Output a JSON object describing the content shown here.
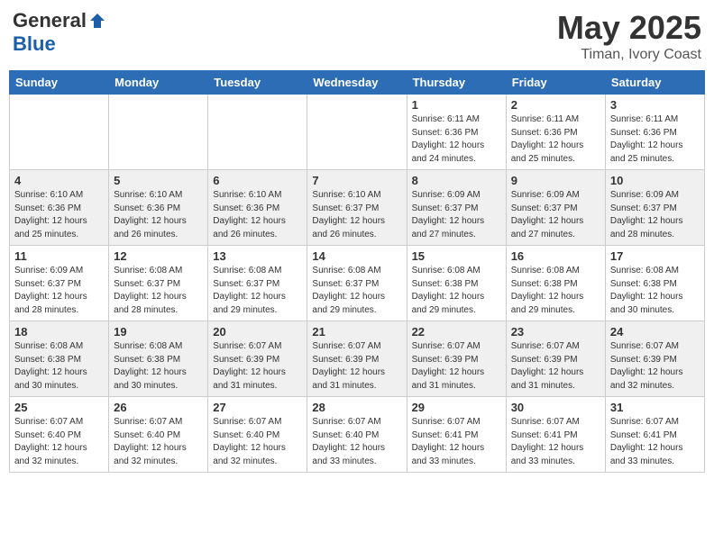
{
  "header": {
    "logo_general": "General",
    "logo_blue": "Blue",
    "title": "May 2025",
    "location": "Timan, Ivory Coast"
  },
  "weekdays": [
    "Sunday",
    "Monday",
    "Tuesday",
    "Wednesday",
    "Thursday",
    "Friday",
    "Saturday"
  ],
  "rows": [
    [
      {
        "day": "",
        "info": ""
      },
      {
        "day": "",
        "info": ""
      },
      {
        "day": "",
        "info": ""
      },
      {
        "day": "",
        "info": ""
      },
      {
        "day": "1",
        "info": "Sunrise: 6:11 AM\nSunset: 6:36 PM\nDaylight: 12 hours\nand 24 minutes."
      },
      {
        "day": "2",
        "info": "Sunrise: 6:11 AM\nSunset: 6:36 PM\nDaylight: 12 hours\nand 25 minutes."
      },
      {
        "day": "3",
        "info": "Sunrise: 6:11 AM\nSunset: 6:36 PM\nDaylight: 12 hours\nand 25 minutes."
      }
    ],
    [
      {
        "day": "4",
        "info": "Sunrise: 6:10 AM\nSunset: 6:36 PM\nDaylight: 12 hours\nand 25 minutes."
      },
      {
        "day": "5",
        "info": "Sunrise: 6:10 AM\nSunset: 6:36 PM\nDaylight: 12 hours\nand 26 minutes."
      },
      {
        "day": "6",
        "info": "Sunrise: 6:10 AM\nSunset: 6:36 PM\nDaylight: 12 hours\nand 26 minutes."
      },
      {
        "day": "7",
        "info": "Sunrise: 6:10 AM\nSunset: 6:37 PM\nDaylight: 12 hours\nand 26 minutes."
      },
      {
        "day": "8",
        "info": "Sunrise: 6:09 AM\nSunset: 6:37 PM\nDaylight: 12 hours\nand 27 minutes."
      },
      {
        "day": "9",
        "info": "Sunrise: 6:09 AM\nSunset: 6:37 PM\nDaylight: 12 hours\nand 27 minutes."
      },
      {
        "day": "10",
        "info": "Sunrise: 6:09 AM\nSunset: 6:37 PM\nDaylight: 12 hours\nand 28 minutes."
      }
    ],
    [
      {
        "day": "11",
        "info": "Sunrise: 6:09 AM\nSunset: 6:37 PM\nDaylight: 12 hours\nand 28 minutes."
      },
      {
        "day": "12",
        "info": "Sunrise: 6:08 AM\nSunset: 6:37 PM\nDaylight: 12 hours\nand 28 minutes."
      },
      {
        "day": "13",
        "info": "Sunrise: 6:08 AM\nSunset: 6:37 PM\nDaylight: 12 hours\nand 29 minutes."
      },
      {
        "day": "14",
        "info": "Sunrise: 6:08 AM\nSunset: 6:37 PM\nDaylight: 12 hours\nand 29 minutes."
      },
      {
        "day": "15",
        "info": "Sunrise: 6:08 AM\nSunset: 6:38 PM\nDaylight: 12 hours\nand 29 minutes."
      },
      {
        "day": "16",
        "info": "Sunrise: 6:08 AM\nSunset: 6:38 PM\nDaylight: 12 hours\nand 29 minutes."
      },
      {
        "day": "17",
        "info": "Sunrise: 6:08 AM\nSunset: 6:38 PM\nDaylight: 12 hours\nand 30 minutes."
      }
    ],
    [
      {
        "day": "18",
        "info": "Sunrise: 6:08 AM\nSunset: 6:38 PM\nDaylight: 12 hours\nand 30 minutes."
      },
      {
        "day": "19",
        "info": "Sunrise: 6:08 AM\nSunset: 6:38 PM\nDaylight: 12 hours\nand 30 minutes."
      },
      {
        "day": "20",
        "info": "Sunrise: 6:07 AM\nSunset: 6:39 PM\nDaylight: 12 hours\nand 31 minutes."
      },
      {
        "day": "21",
        "info": "Sunrise: 6:07 AM\nSunset: 6:39 PM\nDaylight: 12 hours\nand 31 minutes."
      },
      {
        "day": "22",
        "info": "Sunrise: 6:07 AM\nSunset: 6:39 PM\nDaylight: 12 hours\nand 31 minutes."
      },
      {
        "day": "23",
        "info": "Sunrise: 6:07 AM\nSunset: 6:39 PM\nDaylight: 12 hours\nand 31 minutes."
      },
      {
        "day": "24",
        "info": "Sunrise: 6:07 AM\nSunset: 6:39 PM\nDaylight: 12 hours\nand 32 minutes."
      }
    ],
    [
      {
        "day": "25",
        "info": "Sunrise: 6:07 AM\nSunset: 6:40 PM\nDaylight: 12 hours\nand 32 minutes."
      },
      {
        "day": "26",
        "info": "Sunrise: 6:07 AM\nSunset: 6:40 PM\nDaylight: 12 hours\nand 32 minutes."
      },
      {
        "day": "27",
        "info": "Sunrise: 6:07 AM\nSunset: 6:40 PM\nDaylight: 12 hours\nand 32 minutes."
      },
      {
        "day": "28",
        "info": "Sunrise: 6:07 AM\nSunset: 6:40 PM\nDaylight: 12 hours\nand 33 minutes."
      },
      {
        "day": "29",
        "info": "Sunrise: 6:07 AM\nSunset: 6:41 PM\nDaylight: 12 hours\nand 33 minutes."
      },
      {
        "day": "30",
        "info": "Sunrise: 6:07 AM\nSunset: 6:41 PM\nDaylight: 12 hours\nand 33 minutes."
      },
      {
        "day": "31",
        "info": "Sunrise: 6:07 AM\nSunset: 6:41 PM\nDaylight: 12 hours\nand 33 minutes."
      }
    ]
  ]
}
